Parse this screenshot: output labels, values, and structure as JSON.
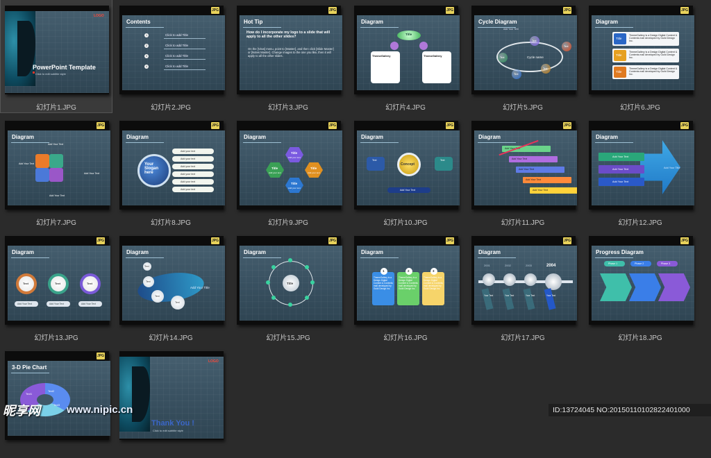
{
  "tiles": [
    {
      "label": "幻灯片1.JPG",
      "kind": "cover",
      "title": "PowerPoint Template",
      "subtitle": "Click to edit subtitle style",
      "logo": "LOGO"
    },
    {
      "label": "幻灯片2.JPG",
      "kind": "contents",
      "title": "Contents",
      "items": [
        "Click to add Title",
        "Click to add Title",
        "Click to add Title",
        "Click to add Title"
      ]
    },
    {
      "label": "幻灯片3.JPG",
      "kind": "tip",
      "title": "Hot Tip",
      "q": "How do I incorporate my logo to a slide that will apply to all the other slides?",
      "a": "On the [View] menu, point to [Master], and then click [Slide Master] or [Notes Master]. Change images to the one you like, then it will apply to all the other slides."
    },
    {
      "label": "幻灯片4.JPG",
      "kind": "flow",
      "title": "Diagram",
      "center": "Title",
      "boxes": [
        "ThemeGallery",
        "ThemeGallery"
      ]
    },
    {
      "label": "幻灯片5.JPG",
      "kind": "cycle",
      "title": "Cycle Diagram",
      "center": "Cycle name",
      "nodes": [
        "Text",
        "Text",
        "Text",
        "Text",
        "Text"
      ],
      "top": "Add Your Text"
    },
    {
      "label": "幻灯片6.JPG",
      "kind": "list",
      "title": "Diagram",
      "items": [
        "Title",
        "Title",
        "Title"
      ],
      "body": "ThemeGallery is a Design Digital Content & Contents mall developed by Guild Design Inc."
    },
    {
      "label": "幻灯片7.JPG",
      "kind": "puzzle",
      "title": "Diagram",
      "texts": [
        "Add Your Text",
        "Add Your Text",
        "Add Your Text",
        "Add Your Text"
      ]
    },
    {
      "label": "幻灯片8.JPG",
      "kind": "slogan",
      "title": "Diagram",
      "center": "Your Slogan here",
      "items": [
        "Add your text",
        "Add your text",
        "Add your text",
        "Add your text",
        "Add your text",
        "Add your text"
      ]
    },
    {
      "label": "幻灯片9.JPG",
      "kind": "hex",
      "title": "Diagram",
      "hexes": [
        "Title",
        "Title",
        "Title",
        "Title"
      ],
      "sub": "Add your text"
    },
    {
      "label": "幻灯片10.JPG",
      "kind": "concept",
      "title": "Diagram",
      "center": "Concept",
      "bottom": "Add Your Text",
      "side": "Text"
    },
    {
      "label": "幻灯片11.JPG",
      "kind": "stairs",
      "title": "Diagram",
      "steps": [
        "Add Your Text",
        "Add Your Text",
        "Add Your Text",
        "Add Your Text",
        "Add Your Text"
      ]
    },
    {
      "label": "幻灯片12.JPG",
      "kind": "arrow",
      "title": "Diagram",
      "bars": [
        "Add Your Text",
        "Add Your Text",
        "Add Your Text"
      ],
      "right": "Add Your Title"
    },
    {
      "label": "幻灯片13.JPG",
      "kind": "rings",
      "title": "Diagram",
      "rings": [
        "Text",
        "Text",
        "Text"
      ],
      "caps": [
        "Add Your Text",
        "Add Your Text",
        "Add Your Text"
      ]
    },
    {
      "label": "幻灯片14.JPG",
      "kind": "spiral",
      "title": "Diagram",
      "bubbles": [
        "Text",
        "Text",
        "Text",
        "Text"
      ],
      "side": "Add Your Title"
    },
    {
      "label": "幻灯片15.JPG",
      "kind": "radial",
      "title": "Diagram",
      "center": "Title"
    },
    {
      "label": "幻灯片16.JPG",
      "kind": "cards",
      "title": "Diagram",
      "nums": [
        "1",
        "2",
        "3"
      ],
      "body": "ThemeGallery is a Design Digital Content & Contents mall developed by Guild Design Inc."
    },
    {
      "label": "幻灯片17.JPG",
      "kind": "timeline",
      "title": "Diagram",
      "years": [
        "2001",
        "2002",
        "2003",
        "2004"
      ],
      "tags": [
        "Your Text",
        "Your Text",
        "Your Text",
        "Your Text"
      ]
    },
    {
      "label": "幻灯片18.JPG",
      "kind": "progress",
      "title": "Progress Diagram",
      "phases": [
        "Phase 1",
        "Phase 2",
        "Phase 3"
      ]
    },
    {
      "label": "",
      "kind": "pie",
      "title": "3-D Pie Chart",
      "slices": [
        "Text1",
        "Text2",
        "Text3"
      ]
    },
    {
      "label": "",
      "kind": "end",
      "title": "Thank You !",
      "subtitle": "Click to edit subtitle style",
      "logo": "LOGO"
    }
  ],
  "jpg_badge": "JPG",
  "watermark": "昵享网",
  "watermark_url": "www.nipic.cn",
  "id_text": "ID:13724045 NO:20150110102822401000"
}
